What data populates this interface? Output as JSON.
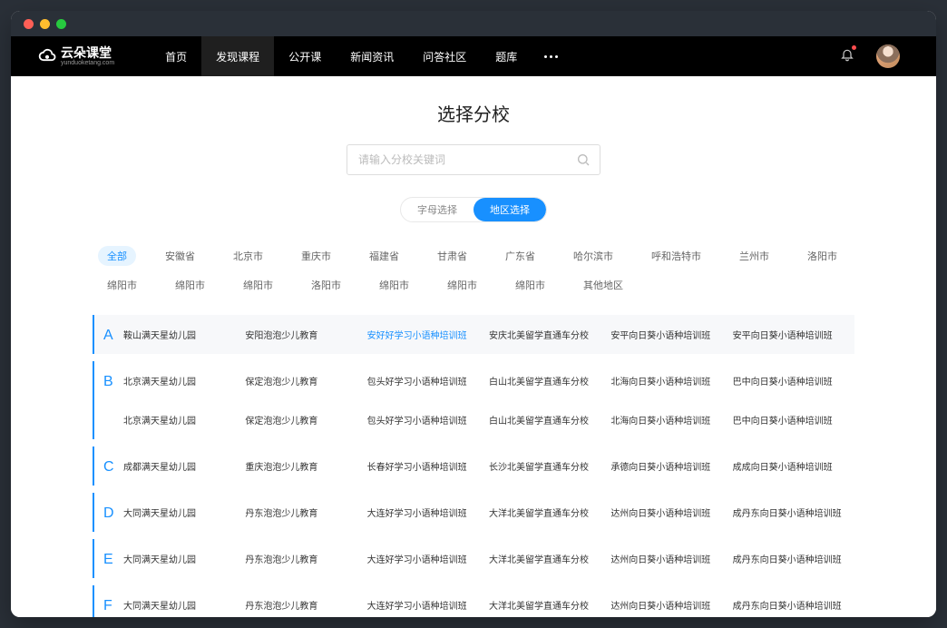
{
  "logo": {
    "text": "云朵课堂",
    "sub": "yunduoketang.com"
  },
  "nav": [
    "首页",
    "发现课程",
    "公开课",
    "新闻资讯",
    "问答社区",
    "题库"
  ],
  "nav_active": 1,
  "page_title": "选择分校",
  "search": {
    "placeholder": "请输入分校关键词"
  },
  "toggle": {
    "options": [
      "字母选择",
      "地区选择"
    ],
    "active": 1
  },
  "regions": [
    "全部",
    "安徽省",
    "北京市",
    "重庆市",
    "福建省",
    "甘肃省",
    "广东省",
    "哈尔滨市",
    "呼和浩特市",
    "兰州市",
    "洛阳市",
    "绵阳市",
    "绵阳市",
    "绵阳市",
    "洛阳市",
    "绵阳市",
    "绵阳市",
    "绵阳市",
    "其他地区"
  ],
  "region_active": 0,
  "sections": [
    {
      "letter": "A",
      "rows": [
        [
          "鞍山满天星幼儿园",
          "安阳泡泡少儿教育",
          "安好好学习小语种培训班",
          "安庆北美留学直通车分校",
          "安平向日葵小语种培训班",
          "安平向日葵小语种培训班"
        ]
      ],
      "active_idx": 2
    },
    {
      "letter": "B",
      "rows": [
        [
          "北京满天星幼儿园",
          "保定泡泡少儿教育",
          "包头好学习小语种培训班",
          "白山北美留学直通车分校",
          "北海向日葵小语种培训班",
          "巴中向日葵小语种培训班"
        ],
        [
          "北京满天星幼儿园",
          "保定泡泡少儿教育",
          "包头好学习小语种培训班",
          "白山北美留学直通车分校",
          "北海向日葵小语种培训班",
          "巴中向日葵小语种培训班"
        ]
      ]
    },
    {
      "letter": "C",
      "rows": [
        [
          "成都满天星幼儿园",
          "重庆泡泡少儿教育",
          "长春好学习小语种培训班",
          "长沙北美留学直通车分校",
          "承德向日葵小语种培训班",
          "成成向日葵小语种培训班"
        ]
      ]
    },
    {
      "letter": "D",
      "rows": [
        [
          "大同满天星幼儿园",
          "丹东泡泡少儿教育",
          "大连好学习小语种培训班",
          "大洋北美留学直通车分校",
          "达州向日葵小语种培训班",
          "成丹东向日葵小语种培训班"
        ]
      ]
    },
    {
      "letter": "E",
      "rows": [
        [
          "大同满天星幼儿园",
          "丹东泡泡少儿教育",
          "大连好学习小语种培训班",
          "大洋北美留学直通车分校",
          "达州向日葵小语种培训班",
          "成丹东向日葵小语种培训班"
        ]
      ]
    },
    {
      "letter": "F",
      "rows": [
        [
          "大同满天星幼儿园",
          "丹东泡泡少儿教育",
          "大连好学习小语种培训班",
          "大洋北美留学直通车分校",
          "达州向日葵小语种培训班",
          "成丹东向日葵小语种培训班"
        ]
      ]
    }
  ]
}
